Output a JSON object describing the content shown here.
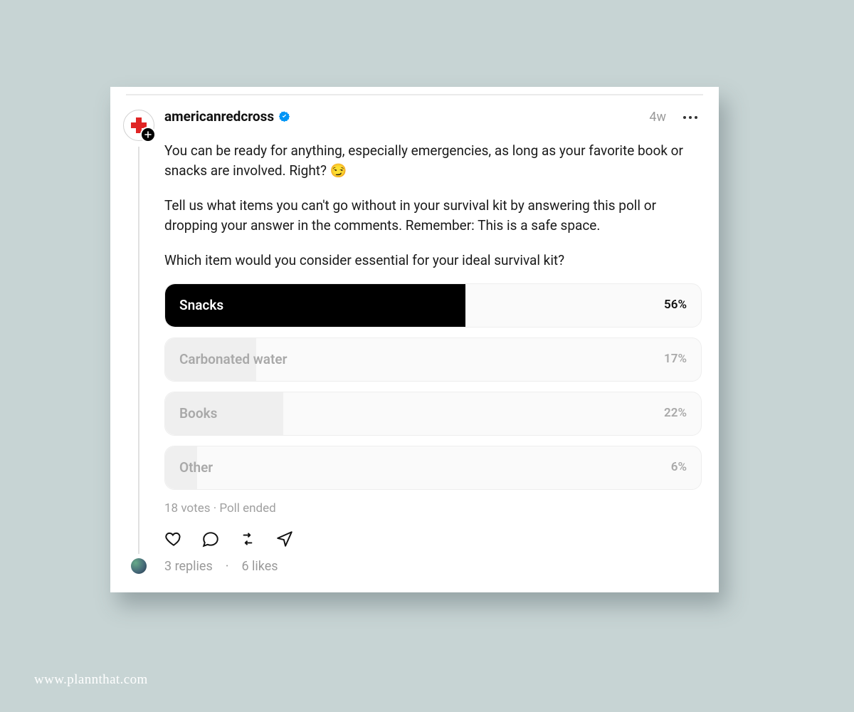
{
  "post": {
    "username": "americanredcross",
    "verified": true,
    "timestamp": "4w",
    "paragraphs": [
      "You can be ready for anything, especially emergencies, as long as your favorite book or snacks are involved. Right? 😏",
      "Tell us what items you can't go without in your survival kit by answering this poll or dropping your answer in the comments. Remember: This is a safe space.",
      "Which item would you consider essential for your ideal survival kit?"
    ]
  },
  "poll": {
    "options": [
      {
        "label": "Snacks",
        "percent": 56,
        "winner": true
      },
      {
        "label": "Carbonated water",
        "percent": 17,
        "winner": false
      },
      {
        "label": "Books",
        "percent": 22,
        "winner": false
      },
      {
        "label": "Other",
        "percent": 6,
        "winner": false
      }
    ],
    "meta": "18 votes · Poll ended"
  },
  "footer": {
    "replies": "3 replies",
    "likes": "6 likes"
  },
  "watermark": "www.plannthat.com"
}
